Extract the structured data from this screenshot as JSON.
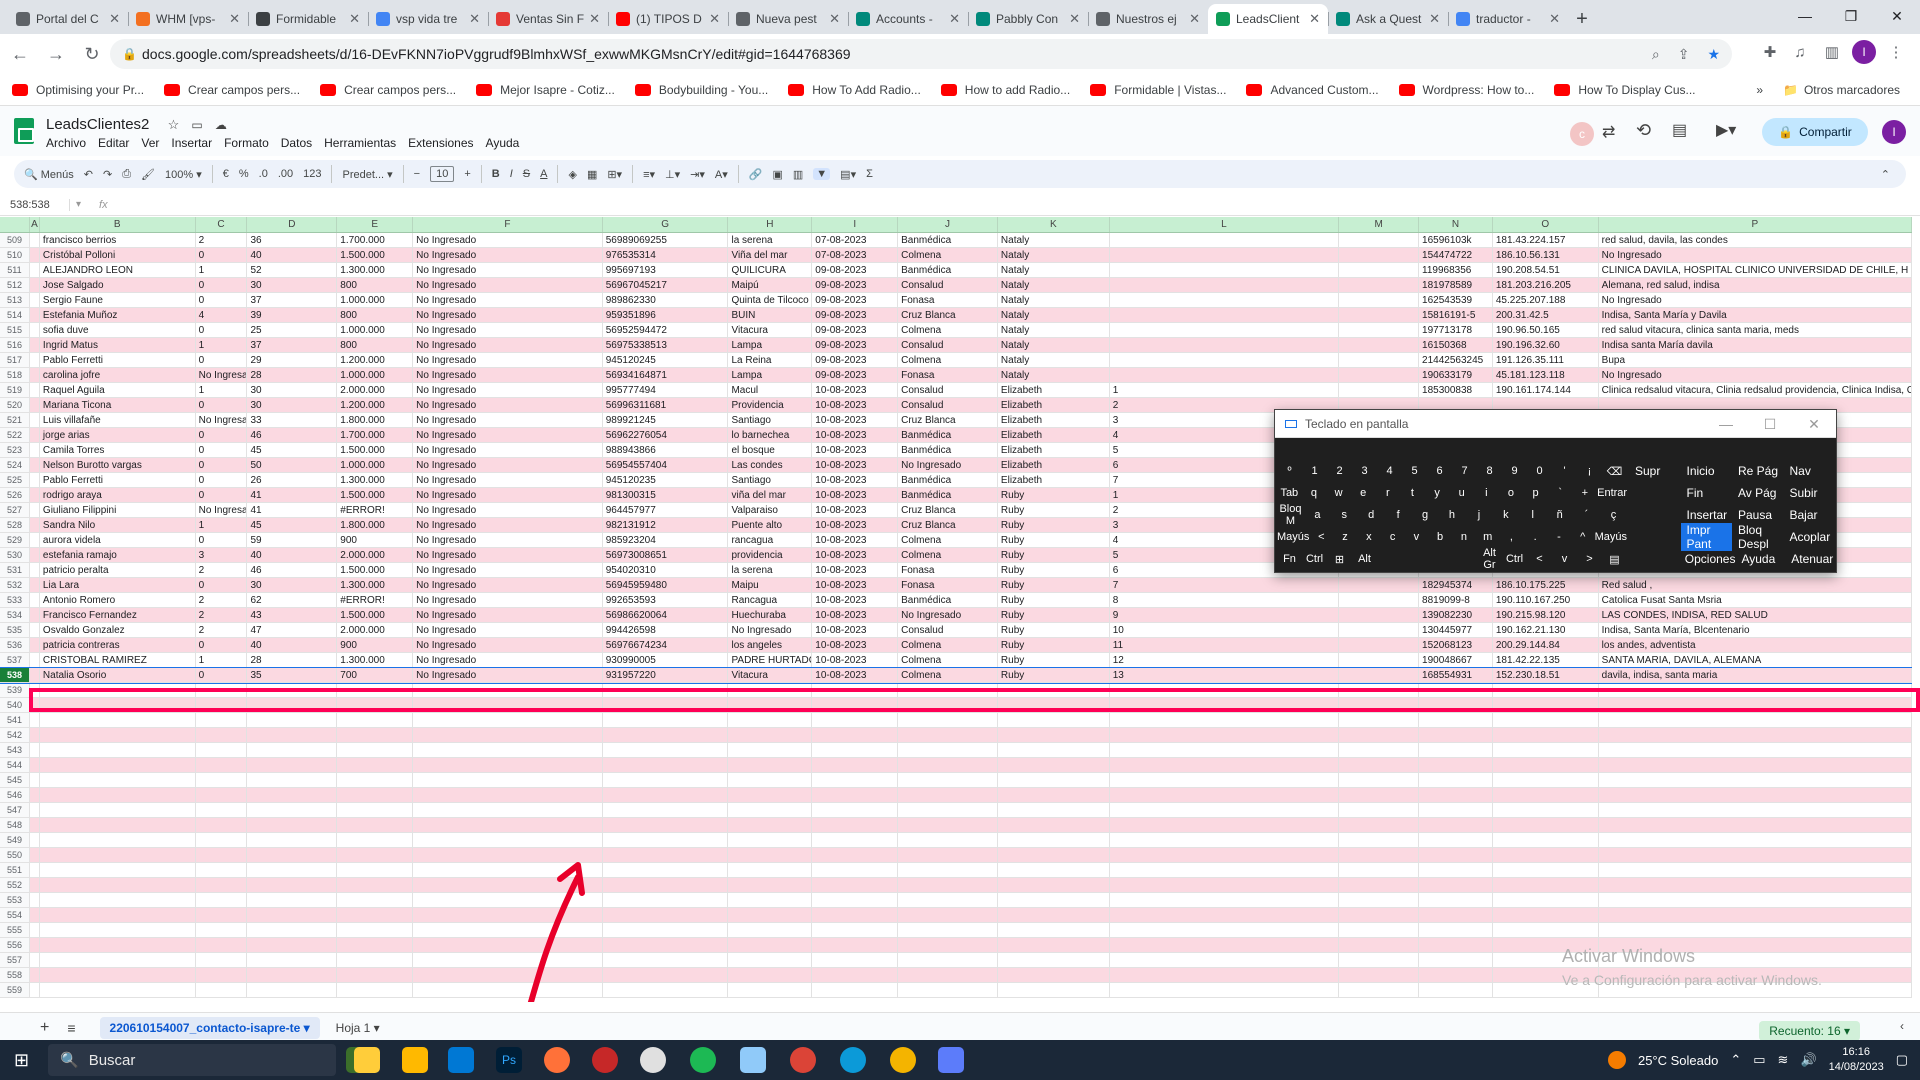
{
  "browser": {
    "tabs": [
      {
        "title": "Portal del C",
        "color": "#5f6368"
      },
      {
        "title": "WHM [vps-",
        "color": "#f37021"
      },
      {
        "title": "Formidable",
        "color": "#3c4043"
      },
      {
        "title": "vsp vida tre",
        "color": "#4285f4"
      },
      {
        "title": "Ventas Sin F",
        "color": "#e53935"
      },
      {
        "title": "(1) TIPOS D",
        "color": "#ff0000"
      },
      {
        "title": "Nueva pest",
        "color": "#5f6368"
      },
      {
        "title": "Accounts -",
        "color": "#00897b"
      },
      {
        "title": "Pabbly Con",
        "color": "#00897b"
      },
      {
        "title": "Nuestros ej",
        "color": "#5f6368"
      },
      {
        "title": "LeadsClient",
        "color": "#0f9d58",
        "active": true
      },
      {
        "title": "Ask a Quest",
        "color": "#00897b"
      },
      {
        "title": "traductor -",
        "color": "#4285f4"
      }
    ],
    "url": "docs.google.com/spreadsheets/d/16-DEvFKNN7ioPVggrudf9BlmhxWSf_exwwMKGMsnCrY/edit#gid=1644768369",
    "bookmarks": [
      "Optimising your Pr...",
      "Crear campos pers...",
      "Crear campos pers...",
      "Mejor Isapre - Cotiz...",
      "Bodybuilding - You...",
      "How To Add Radio...",
      "How to add Radio...",
      "Formidable | Vistas...",
      "Advanced Custom...",
      "Wordpress: How to...",
      "How To Display Cus..."
    ],
    "bookmarks_more": "»",
    "other_bookmarks": "Otros marcadores"
  },
  "sheets": {
    "title": "LeadsClientes2",
    "menus": [
      "Archivo",
      "Editar",
      "Ver",
      "Insertar",
      "Formato",
      "Datos",
      "Herramientas",
      "Extensiones",
      "Ayuda"
    ],
    "share": "Compartir",
    "avatar_letter": "I",
    "toolbar": {
      "menus": "Menús",
      "zoom": "100%",
      "currency": "€",
      "percent": "%",
      "dec1": ".0",
      "dec2": ".00",
      "fmt": "123",
      "font": "Predet...",
      "size": "10"
    },
    "cell_ref": "538:538",
    "fx": "fx",
    "columns": [
      "A",
      "B",
      "C",
      "D",
      "E",
      "F",
      "G",
      "H",
      "I",
      "J",
      "K",
      "L",
      "M",
      "N",
      "O",
      "P"
    ],
    "rows": [
      [
        "509",
        "francisco berrios",
        "2",
        "36",
        "1.700.000",
        "No Ingresado",
        "56989069255",
        "la serena",
        "07-08-2023",
        "Banmédica",
        "Nataly",
        "",
        "",
        "16596103k",
        "181.43.224.157",
        "red salud, davila, las condes"
      ],
      [
        "510",
        "Cristóbal Polloni",
        "0",
        "40",
        "1.500.000",
        "No Ingresado",
        "976535314",
        "Viña del mar",
        "07-08-2023",
        "Colmena",
        "Nataly",
        "",
        "",
        "154474722",
        "186.10.56.131",
        "No Ingresado"
      ],
      [
        "511",
        "ALEJANDRO LEON",
        "1",
        "52",
        "1.300.000",
        "No Ingresado",
        "995697193",
        "QUILICURA",
        "09-08-2023",
        "Banmédica",
        "Nataly",
        "",
        "",
        "119968356",
        "190.208.54.51",
        "CLINICA DAVILA, HOSPITAL CLINICO UNIVERSIDAD DE CHILE, H"
      ],
      [
        "512",
        "Jose Salgado",
        "0",
        "30",
        "800",
        "No Ingresado",
        "56967045217",
        "Maipú",
        "09-08-2023",
        "Consalud",
        "Nataly",
        "",
        "",
        "181978589",
        "181.203.216.205",
        "Alemana, red salud, indisa"
      ],
      [
        "513",
        "Sergio Faune",
        "0",
        "37",
        "1.000.000",
        "No Ingresado",
        "989862330",
        "Quinta de Tilcoco",
        "09-08-2023",
        "Fonasa",
        "Nataly",
        "",
        "",
        "162543539",
        "45.225.207.188",
        "No Ingresado"
      ],
      [
        "514",
        "Estefania Muñoz",
        "4",
        "39",
        "800",
        "No Ingresado",
        "959351896",
        "BUIN",
        "09-08-2023",
        "Cruz Blanca",
        "Nataly",
        "",
        "",
        "15816191-5",
        "200.31.42.5",
        "Indisa, Santa María y Davila"
      ],
      [
        "515",
        "sofia duve",
        "0",
        "25",
        "1.000.000",
        "No Ingresado",
        "56952594472",
        "Vitacura",
        "09-08-2023",
        "Colmena",
        "Nataly",
        "",
        "",
        "197713178",
        "190.96.50.165",
        "red salud vitacura, clinica santa maria, meds"
      ],
      [
        "516",
        "Ingrid Matus",
        "1",
        "37",
        "800",
        "No Ingresado",
        "56975338513",
        "Lampa",
        "09-08-2023",
        "Consalud",
        "Nataly",
        "",
        "",
        "16150368",
        "190.196.32.60",
        "Indisa santa María davila"
      ],
      [
        "517",
        "Pablo Ferretti",
        "0",
        "29",
        "1.200.000",
        "No Ingresado",
        "945120245",
        "La Reina",
        "09-08-2023",
        "Colmena",
        "Nataly",
        "",
        "",
        "21442563245",
        "191.126.35.111",
        "Bupa"
      ],
      [
        "518",
        "carolina jofre",
        "No Ingresad",
        "28",
        "1.000.000",
        "No Ingresado",
        "56934164871",
        "Lampa",
        "09-08-2023",
        "Fonasa",
        "Nataly",
        "",
        "",
        "190633179",
        "45.181.123.118",
        "No Ingresado"
      ],
      [
        "519",
        "Raquel Aguila",
        "1",
        "30",
        "2.000.000",
        "No Ingresado",
        "995777494",
        "Macul",
        "10-08-2023",
        "Consalud",
        "Elizabeth",
        "1",
        "",
        "185300838",
        "190.161.174.144",
        "Clinica redsalud vitacura, Clinia redsalud providencia, Clinica Indisa, C"
      ],
      [
        "520",
        "Mariana Ticona",
        "0",
        "30",
        "1.200.000",
        "No Ingresado",
        "56996311681",
        "Providencia",
        "10-08-2023",
        "Consalud",
        "Elizabeth",
        "2",
        "",
        "",
        "",
        ""
      ],
      [
        "521",
        "Luis villafañe",
        "No Ingresad",
        "33",
        "1.800.000",
        "No Ingresado",
        "989921245",
        "Santiago",
        "10-08-2023",
        "Cruz Blanca",
        "Elizabeth",
        "3",
        "",
        "",
        "",
        ""
      ],
      [
        "522",
        "jorge arias",
        "0",
        "46",
        "1.700.000",
        "No Ingresado",
        "56962276054",
        "lo barnechea",
        "10-08-2023",
        "Banmédica",
        "Elizabeth",
        "4",
        "",
        "",
        "",
        ""
      ],
      [
        "523",
        "Camila Torres",
        "0",
        "45",
        "1.500.000",
        "No Ingresado",
        "988943866",
        "el bosque",
        "10-08-2023",
        "Banmédica",
        "Elizabeth",
        "5",
        "",
        "",
        "",
        ""
      ],
      [
        "524",
        "Nelson Burotto vargas",
        "0",
        "50",
        "1.000.000",
        "No Ingresado",
        "56954557404",
        "Las condes",
        "10-08-2023",
        "No Ingresado",
        "Elizabeth",
        "6",
        "",
        "",
        "",
        ""
      ],
      [
        "525",
        "Pablo Ferretti",
        "0",
        "26",
        "1.300.000",
        "No Ingresado",
        "945120235",
        "Santiago",
        "10-08-2023",
        "Banmédica",
        "Elizabeth",
        "7",
        "",
        "",
        "",
        ""
      ],
      [
        "526",
        "rodrigo araya",
        "0",
        "41",
        "1.500.000",
        "No Ingresado",
        "981300315",
        "viña del mar",
        "10-08-2023",
        "Banmédica",
        "Ruby",
        "1",
        "",
        "",
        "",
        ""
      ],
      [
        "527",
        "Giuliano Filippini",
        "No Ingresad",
        "41",
        "#ERROR!",
        "No Ingresado",
        "964457977",
        "Valparaiso",
        "10-08-2023",
        "Cruz Blanca",
        "Ruby",
        "2",
        "",
        "",
        "",
        ""
      ],
      [
        "528",
        "Sandra Nilo",
        "1",
        "45",
        "1.800.000",
        "No Ingresado",
        "982131912",
        "Puente alto",
        "10-08-2023",
        "Cruz Blanca",
        "Ruby",
        "3",
        "",
        "",
        "",
        ""
      ],
      [
        "529",
        "aurora videla",
        "0",
        "59",
        "900",
        "No Ingresado",
        "985923204",
        "rancagua",
        "10-08-2023",
        "Colmena",
        "Ruby",
        "4",
        "",
        "",
        "",
        ""
      ],
      [
        "530",
        "estefania ramajo",
        "3",
        "40",
        "2.000.000",
        "No Ingresado",
        "56973008651",
        "providencia",
        "10-08-2023",
        "Colmena",
        "Ruby",
        "5",
        "",
        "",
        "",
        ""
      ],
      [
        "531",
        "patricio peralta",
        "2",
        "46",
        "1.500.000",
        "No Ingresado",
        "954020310",
        "la serena",
        "10-08-2023",
        "Fonasa",
        "Ruby",
        "6",
        "",
        "",
        "",
        ""
      ],
      [
        "532",
        "Lia Lara",
        "0",
        "30",
        "1.300.000",
        "No Ingresado",
        "56945959480",
        "Maipu",
        "10-08-2023",
        "Fonasa",
        "Ruby",
        "7",
        "",
        "182945374",
        "186.10.175.225",
        "Red salud ,"
      ],
      [
        "533",
        "Antonio Romero",
        "2",
        "62",
        "#ERROR!",
        "No Ingresado",
        "992653593",
        "Rancagua",
        "10-08-2023",
        "Banmédica",
        "Ruby",
        "8",
        "",
        "8819099-8",
        "190.110.167.250",
        "Catolica Fusat Santa Msria"
      ],
      [
        "534",
        "Francisco Fernandez",
        "2",
        "43",
        "1.500.000",
        "No Ingresado",
        "56986620064",
        "Huechuraba",
        "10-08-2023",
        "No Ingresado",
        "Ruby",
        "9",
        "",
        "139082230",
        "190.215.98.120",
        "LAS CONDES, INDISA, RED SALUD"
      ],
      [
        "535",
        "Osvaldo Gonzalez",
        "2",
        "47",
        "2.000.000",
        "No Ingresado",
        "994426598",
        "No Ingresado",
        "10-08-2023",
        "Consalud",
        "Ruby",
        "10",
        "",
        "130445977",
        "190.162.21.130",
        "Indisa, Santa María, Blcentenario"
      ],
      [
        "536",
        "patricia contreras",
        "0",
        "40",
        "900",
        "No Ingresado",
        "56976674234",
        "los angeles",
        "10-08-2023",
        "Colmena",
        "Ruby",
        "11",
        "",
        "152068123",
        "200.29.144.84",
        "los andes, adventista"
      ],
      [
        "537",
        "CRISTOBAL RAMIREZ",
        "1",
        "28",
        "1.300.000",
        "No Ingresado",
        "930990005",
        "PADRE HURTADO",
        "10-08-2023",
        "Colmena",
        "Ruby",
        "12",
        "",
        "190048667",
        "181.42.22.135",
        "SANTA MARIA, DAVILA, ALEMANA"
      ],
      [
        "538",
        "Natalia Osorio",
        "0",
        "35",
        "700",
        "No Ingresado",
        "931957220",
        "Vitacura",
        "10-08-2023",
        "Colmena",
        "Ruby",
        "13",
        "",
        "168554931",
        "152.230.18.51",
        "davila, indisa, santa maria"
      ]
    ],
    "empty_rows": [
      "539",
      "540",
      "541",
      "542",
      "543",
      "544",
      "545",
      "546",
      "547",
      "548",
      "549",
      "550",
      "551",
      "552",
      "553",
      "554",
      "555",
      "556",
      "557",
      "558",
      "559"
    ],
    "sheet_tabs": [
      "220610154007_contacto-isapre-te",
      "Hoja 1"
    ],
    "recuento": "Recuento: 16"
  },
  "watermark": {
    "line1": "Activar Windows",
    "line2": "Ve a Configuración para activar Windows."
  },
  "osk": {
    "title": "Teclado en pantalla",
    "rows": [
      [
        "º",
        "1",
        "2",
        "3",
        "4",
        "5",
        "6",
        "7",
        "8",
        "9",
        "0",
        "'",
        "¡",
        "⌫"
      ],
      [
        "Tab",
        "q",
        "w",
        "e",
        "r",
        "t",
        "y",
        "u",
        "i",
        "o",
        "p",
        "`",
        "+",
        "Entrar"
      ],
      [
        "Bloq M",
        "a",
        "s",
        "d",
        "f",
        "g",
        "h",
        "j",
        "k",
        "l",
        "ñ",
        "´",
        "ç"
      ],
      [
        "Mayús",
        "<",
        "z",
        "x",
        "c",
        "v",
        "b",
        "n",
        "m",
        ",",
        ".",
        "-",
        "^",
        "Mayús"
      ],
      [
        "Fn",
        "Ctrl",
        "⊞",
        "Alt",
        "",
        "",
        "",
        "",
        "Alt Gr",
        "Ctrl",
        "<",
        "v",
        ">",
        "▤"
      ]
    ],
    "nav": [
      [
        "Supr",
        "Inicio",
        "Re Pág",
        "Nav"
      ],
      [
        "",
        "Fin",
        "Av Pág",
        "Subir"
      ],
      [
        "",
        "Insertar",
        "Pausa",
        "Bajar"
      ],
      [
        "",
        "Impr Pant",
        "Bloq Despl",
        "Acoplar"
      ],
      [
        "",
        "Opciones",
        "Ayuda",
        "Atenuar"
      ]
    ]
  },
  "taskbar": {
    "search": "Buscar",
    "weather": "25°C Soleado",
    "time": "16:16",
    "date": "14/08/2023"
  }
}
